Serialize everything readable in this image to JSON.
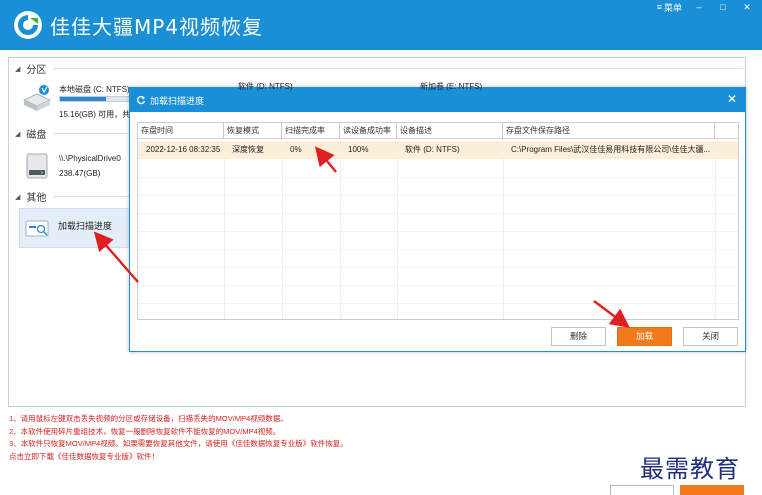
{
  "app": {
    "title": "佳佳大疆MP4视频恢复",
    "menu_label": "菜单",
    "min_label": "–",
    "max_label": "□",
    "close_label": "✕"
  },
  "sections": {
    "partition": "分区",
    "disk": "磁盘",
    "other": "其他"
  },
  "drives": {
    "local": {
      "name": "本地磁盘 (C: NTFS)",
      "size": "15.16(GB) 可用，共",
      "progress": 0.62,
      "second_label": "软件 (D: NTFS)",
      "third_label": "新加卷 (E: NTFS)"
    },
    "physical": {
      "name": "\\\\.\\PhysicalDrive0",
      "size": "238.47(GB)"
    }
  },
  "scan_item": {
    "label": "加载扫描进度"
  },
  "dialog": {
    "title": "加载扫描进度",
    "close": "✕",
    "columns": [
      "存盘时间",
      "恢复模式",
      "扫描完成率",
      "读设备成功率",
      "设备描述",
      "存盘文件保存路径"
    ],
    "row": {
      "time": "2022-12-16 08:32:35",
      "mode": "深度恢复",
      "scan_rate": "0%",
      "read_rate": "100%",
      "device": "软件 (D: NTFS)",
      "path": "C:\\Program Files\\武汉佳佳易用科技有限公司\\佳佳大疆..."
    },
    "buttons": {
      "delete": "删除",
      "load": "加载",
      "close": "关闭"
    }
  },
  "notes": [
    "1、请用鼠标左键双击丢失视频的分区或存储设备，扫描丢失的MOV/MP4视频数据。",
    "2、本软件使用碎片重组技术，恢复一般删除恢复软件不能恢复的MOV/MP4视频。",
    "3、本软件只恢复MOV/MP4视频。如果需要恢复其他文件，请使用《佳佳数据恢复专业版》软件恢复。",
    "    点击立即下载《佳佳数据恢复专业版》软件！"
  ],
  "watermark": "最需教育",
  "colors": {
    "brand_blue": "#1a8fd6",
    "accent_orange": "#f07a1c",
    "highlight_row": "#fcefd9",
    "note_red": "#d61f1f",
    "arrow_red": "#e02020"
  }
}
